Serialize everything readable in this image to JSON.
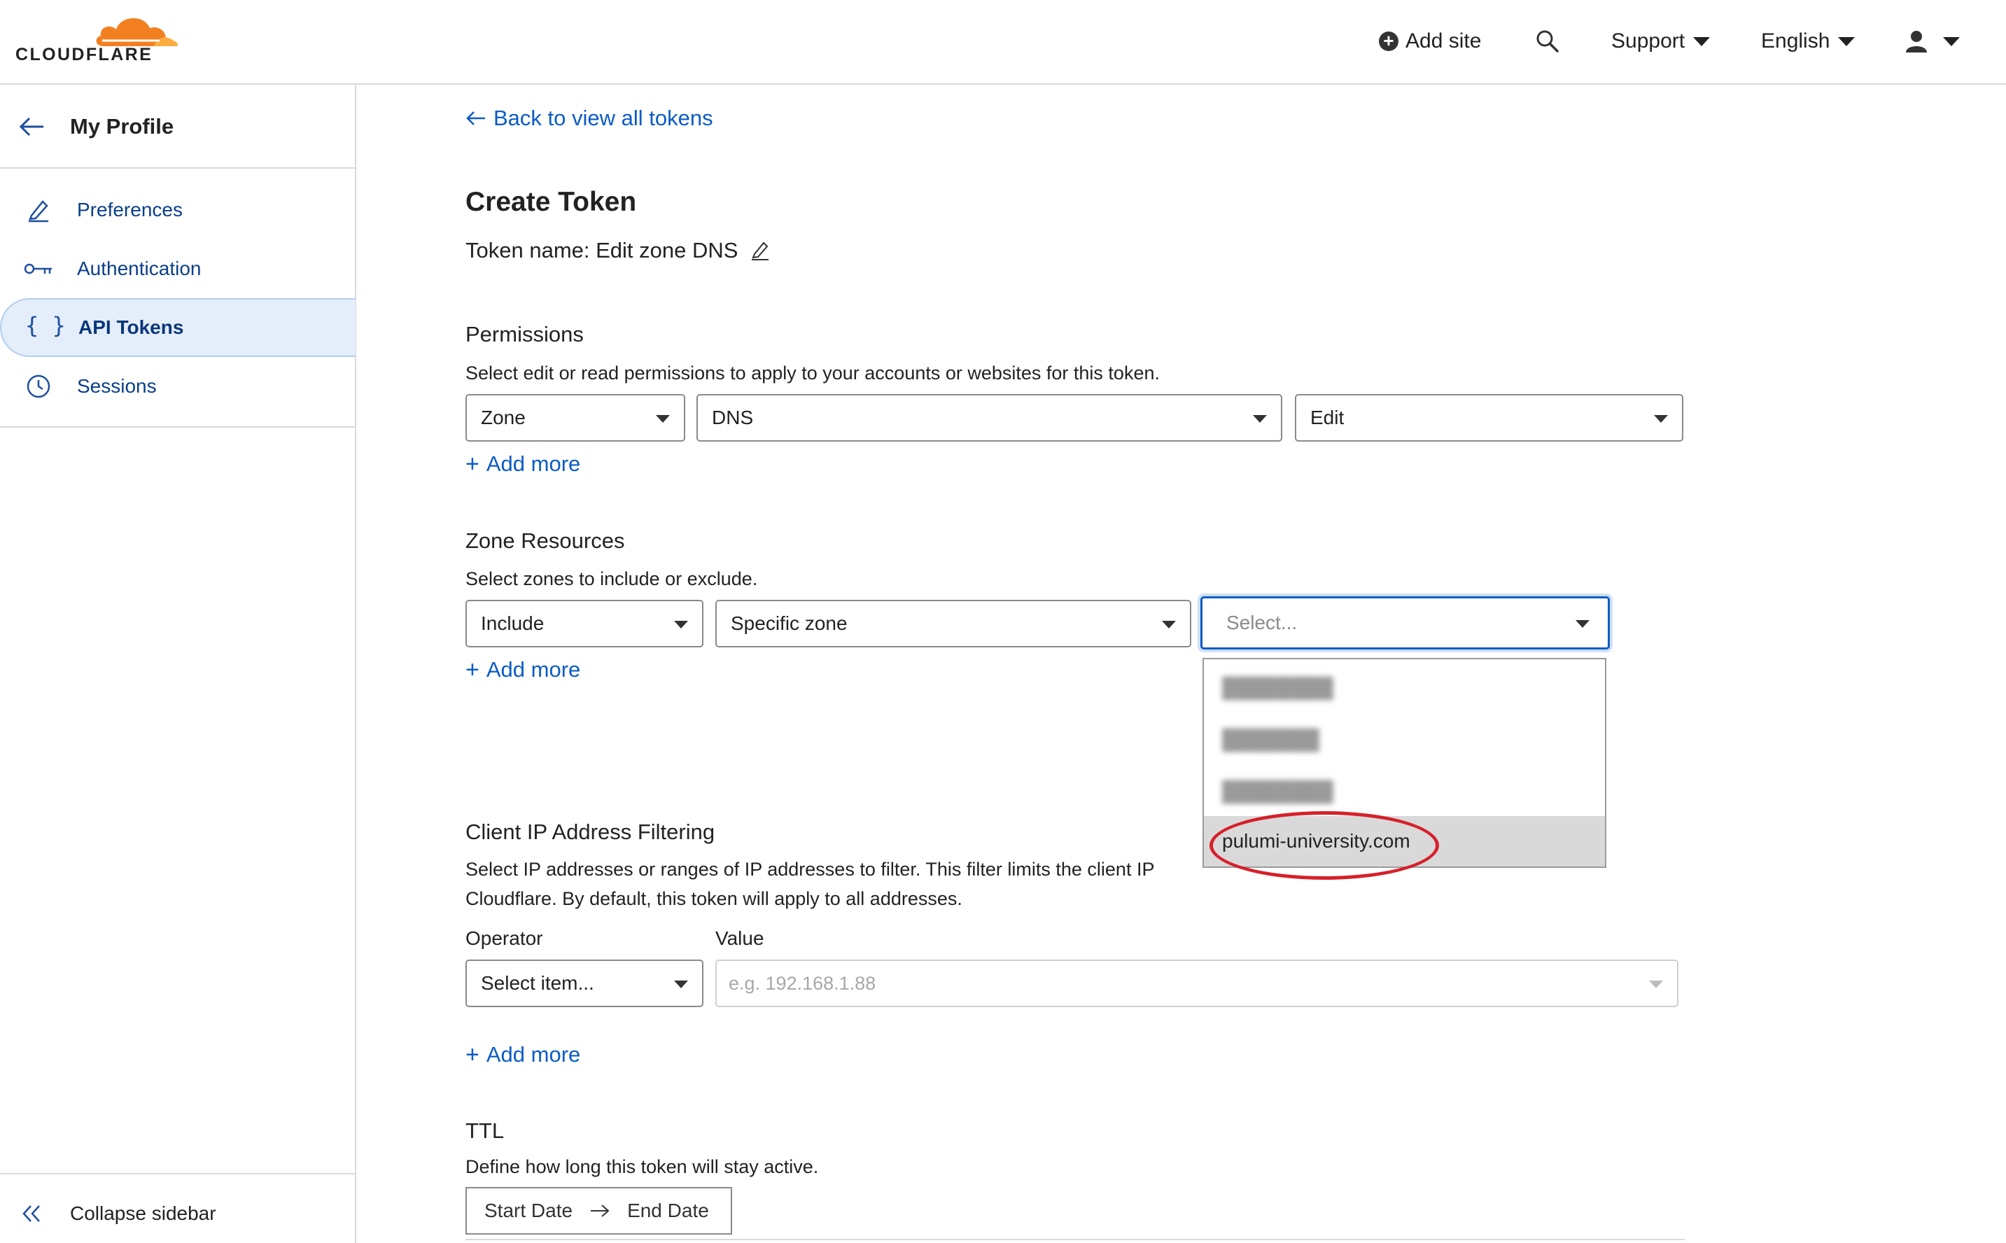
{
  "header": {
    "logo_text": "CLOUDFLARE",
    "add_site": "Add site",
    "support": "Support",
    "language": "English",
    "colors": {
      "brand_orange": "#f38020",
      "link_blue": "#0b5cc4"
    }
  },
  "sidebar": {
    "title": "My Profile",
    "items": [
      {
        "label": "Preferences",
        "icon": "pencil-icon"
      },
      {
        "label": "Authentication",
        "icon": "key-icon"
      },
      {
        "label": "API Tokens",
        "icon": "braces-icon",
        "active": true
      },
      {
        "label": "Sessions",
        "icon": "clock-icon"
      }
    ],
    "collapse_label": "Collapse sidebar"
  },
  "main": {
    "back_link": "Back to view all tokens",
    "title": "Create Token",
    "token_name": "Token name: Edit zone DNS",
    "permissions": {
      "title": "Permissions",
      "description": "Select edit or read permissions to apply to your accounts or websites for this token.",
      "select_1": "Zone",
      "select_2": "DNS",
      "select_3": "Edit",
      "add_more": "Add more"
    },
    "zone_resources": {
      "title": "Zone Resources",
      "description": "Select zones to include or exclude.",
      "select_1": "Include",
      "select_2": "Specific zone",
      "select_3_placeholder": "Select...",
      "add_more": "Add more",
      "dropdown_options": [
        "████████",
        "███████",
        "████████"
      ],
      "highlighted_option": "pulumi-university.com"
    },
    "ip_filtering": {
      "title": "Client IP Address Filtering",
      "description_line1": "Select IP addresses or ranges of IP addresses to filter. This filter limits the client IP",
      "description_line2": "Cloudflare. By default, this token will apply to all addresses.",
      "operator_label": "Operator",
      "value_label": "Value",
      "operator_placeholder": "Select item...",
      "value_placeholder": "e.g. 192.168.1.88",
      "add_more": "Add more"
    },
    "ttl": {
      "title": "TTL",
      "description": "Define how long this token will stay active.",
      "start": "Start Date",
      "end": "End Date"
    }
  }
}
